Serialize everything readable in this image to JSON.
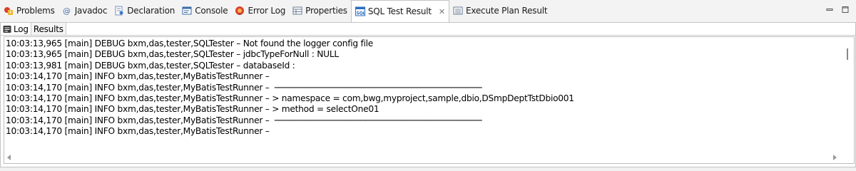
{
  "tabs": [
    {
      "label": "Problems",
      "icon": "problems-icon"
    },
    {
      "label": "Javadoc",
      "icon": "javadoc-icon"
    },
    {
      "label": "Declaration",
      "icon": "declaration-icon"
    },
    {
      "label": "Console",
      "icon": "console-icon"
    },
    {
      "label": "Error Log",
      "icon": "error-log-icon"
    },
    {
      "label": "Properties",
      "icon": "properties-icon"
    },
    {
      "label": "SQL Test Result",
      "icon": "sql-icon",
      "active": true
    },
    {
      "label": "Execute Plan Result",
      "icon": "execute-plan-icon"
    }
  ],
  "subtabs": [
    {
      "label": "Log",
      "icon": "log-icon",
      "active": true
    },
    {
      "label": "Results",
      "active": false
    }
  ],
  "log_lines": [
    "10:03:13,965 [main] DEBUG bxm,das,tester,SQLTester – Not found the logger config file",
    "10:03:13,965 [main] DEBUG bxm,das,tester,SQLTester – jdbcTypeForNull : NULL",
    "10:03:13,981 [main] DEBUG bxm,das,tester,SQLTester – databaseId :",
    "10:03:14,170 [main] INFO bxm,das,tester,MyBatisTestRunner –",
    "10:03:14,170 [main] INFO bxm,das,tester,MyBatisTestRunner –  ─────────────────────────────────────────",
    "10:03:14,170 [main] INFO bxm,das,tester,MyBatisTestRunner – > namespace = com,bwg,myproject,sample,dbio,DSmpDeptTstDbio001",
    "10:03:14,170 [main] INFO bxm,das,tester,MyBatisTestRunner – > method = selectOne01",
    "10:03:14,170 [main] INFO bxm,das,tester,MyBatisTestRunner –  ─────────────────────────────────────────",
    "10:03:14,170 [main] INFO bxm,das,tester,MyBatisTestRunner –"
  ],
  "colors": {
    "accent": "#2c6ebf",
    "error": "#d9412e",
    "tab_bg": "#f3f3f3",
    "panel_bg": "#ffffff"
  }
}
